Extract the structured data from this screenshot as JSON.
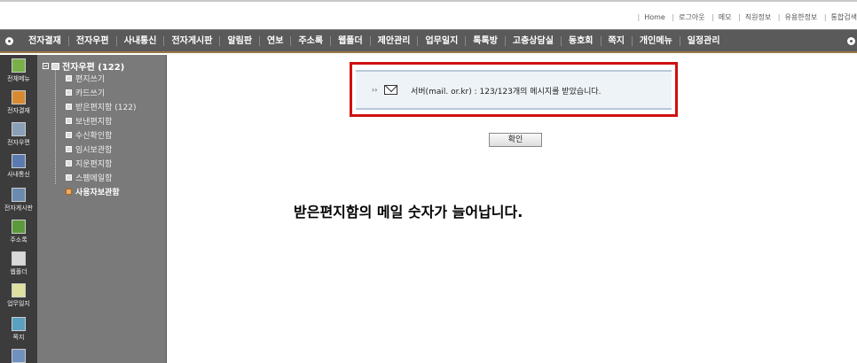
{
  "top_links": [
    "Home",
    "로그아웃",
    "메모",
    "직원정보",
    "유용한정보",
    "통합검색"
  ],
  "nav": [
    "전자결재",
    "전자우편",
    "사내통신",
    "전자게시판",
    "알림판",
    "연보",
    "주소록",
    "웹폴더",
    "제안관리",
    "업무일지",
    "톡톡방",
    "고충상담실",
    "동호회",
    "쪽지",
    "개인메뉴",
    "일정관리"
  ],
  "sidebar_icons": [
    {
      "label": "전체메뉴",
      "icon": "grid-icon",
      "color": "#7ab04a"
    },
    {
      "label": "전자결재",
      "icon": "approval-icon",
      "color": "#d88a30"
    },
    {
      "label": "전자우편",
      "icon": "mail-icon",
      "color": "#8aa0b8"
    },
    {
      "label": "사내통신",
      "icon": "message-icon",
      "color": "#5a7ab0"
    },
    {
      "label": "전자게시판",
      "icon": "board-icon",
      "color": "#6a8ab0"
    },
    {
      "label": "주소록",
      "icon": "addressbook-icon",
      "color": "#5a9a3a"
    },
    {
      "label": "웹폴더",
      "icon": "webfolder-icon",
      "color": "#d8d8d8"
    },
    {
      "label": "업무일지",
      "icon": "journal-icon",
      "color": "#e0e0a0"
    },
    {
      "label": "쪽지",
      "icon": "note-icon",
      "color": "#5aa0c0"
    },
    {
      "label": "",
      "icon": "more-icon",
      "color": "#7090c0"
    }
  ],
  "tree": {
    "root": "전자우편 (122)",
    "items": [
      "편지쓰기",
      "카드쓰기",
      "받은편지함 (122)",
      "보낸편지함",
      "수신확인함",
      "임시보관함",
      "지운편지함",
      "스팸메일함",
      "사용자보관함"
    ]
  },
  "notice": {
    "arrow": "››",
    "text": "서버(mail.          or.kr) : 123/123개의 메시지를 받았습니다."
  },
  "ok_label": "확인",
  "caption": "받은편지함의 메일 숫자가 늘어납니다.",
  "colors": {
    "highlight": "#d01010",
    "nav_bg": "#5a5a5a",
    "tree_bg": "#7a7a7a",
    "iconcol_bg": "#3c3c3c"
  }
}
